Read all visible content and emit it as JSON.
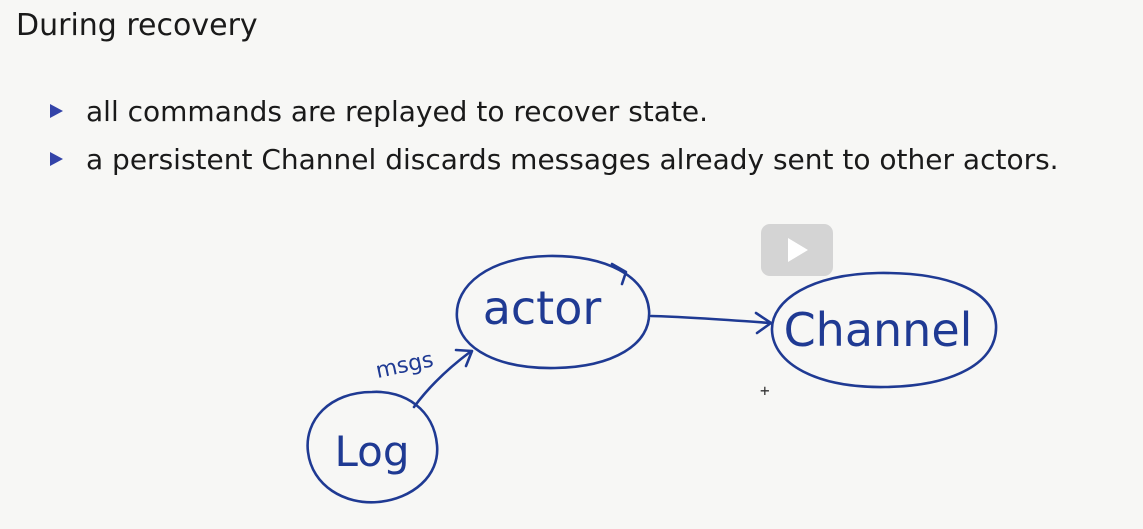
{
  "slide": {
    "title": "During recovery",
    "bullets": [
      "all commands are replayed to recover state.",
      "a persistent Channel discards messages already sent to other actors."
    ]
  },
  "diagram": {
    "nodes": {
      "log": "Log",
      "actor": "actor",
      "channel": "Channel"
    },
    "edge_label": "msgs",
    "ink_color": "#1f3a93"
  },
  "overlay": {
    "icon": "play-icon",
    "cursor_icon": "crosshair-cursor-icon",
    "cursor_glyph": "+"
  },
  "colors": {
    "background": "#f7f7f5",
    "bullet_marker": "#3343a8"
  }
}
